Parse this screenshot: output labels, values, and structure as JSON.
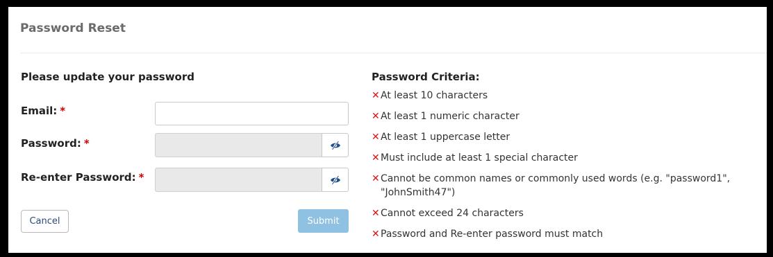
{
  "header": {
    "title": "Password Reset"
  },
  "form": {
    "heading": "Please update your password",
    "required_mark": "*",
    "email": {
      "label": "Email:",
      "value": "",
      "placeholder": ""
    },
    "password": {
      "label": "Password:",
      "value": "",
      "placeholder": ""
    },
    "reenter_password": {
      "label": "Re-enter Password:",
      "value": "",
      "placeholder": ""
    },
    "cancel_label": "Cancel",
    "submit_label": "Submit"
  },
  "criteria": {
    "heading": "Password Criteria:",
    "status_glyph": "✕",
    "items": [
      {
        "text": "At least 10 characters",
        "met": false
      },
      {
        "text": "At least 1 numeric character",
        "met": false
      },
      {
        "text": "At least 1 uppercase letter",
        "met": false
      },
      {
        "text": "Must include at least 1 special character",
        "met": false
      },
      {
        "text": "Cannot be common names or commonly used words (e.g. \"password1\", \"JohnSmith47\")",
        "met": false
      },
      {
        "text": "Cannot exceed 24 characters",
        "met": false
      },
      {
        "text": "Password and Re-enter password must match",
        "met": false
      }
    ]
  },
  "icons": {
    "toggle_visibility": "eye-slash-icon",
    "unmet_criterion": "x-mark-icon"
  },
  "colors": {
    "required": "#d10000",
    "unmet": "#e01010",
    "submit_bg": "#8fc1e3",
    "eye_icon": "#1f4e8c"
  }
}
